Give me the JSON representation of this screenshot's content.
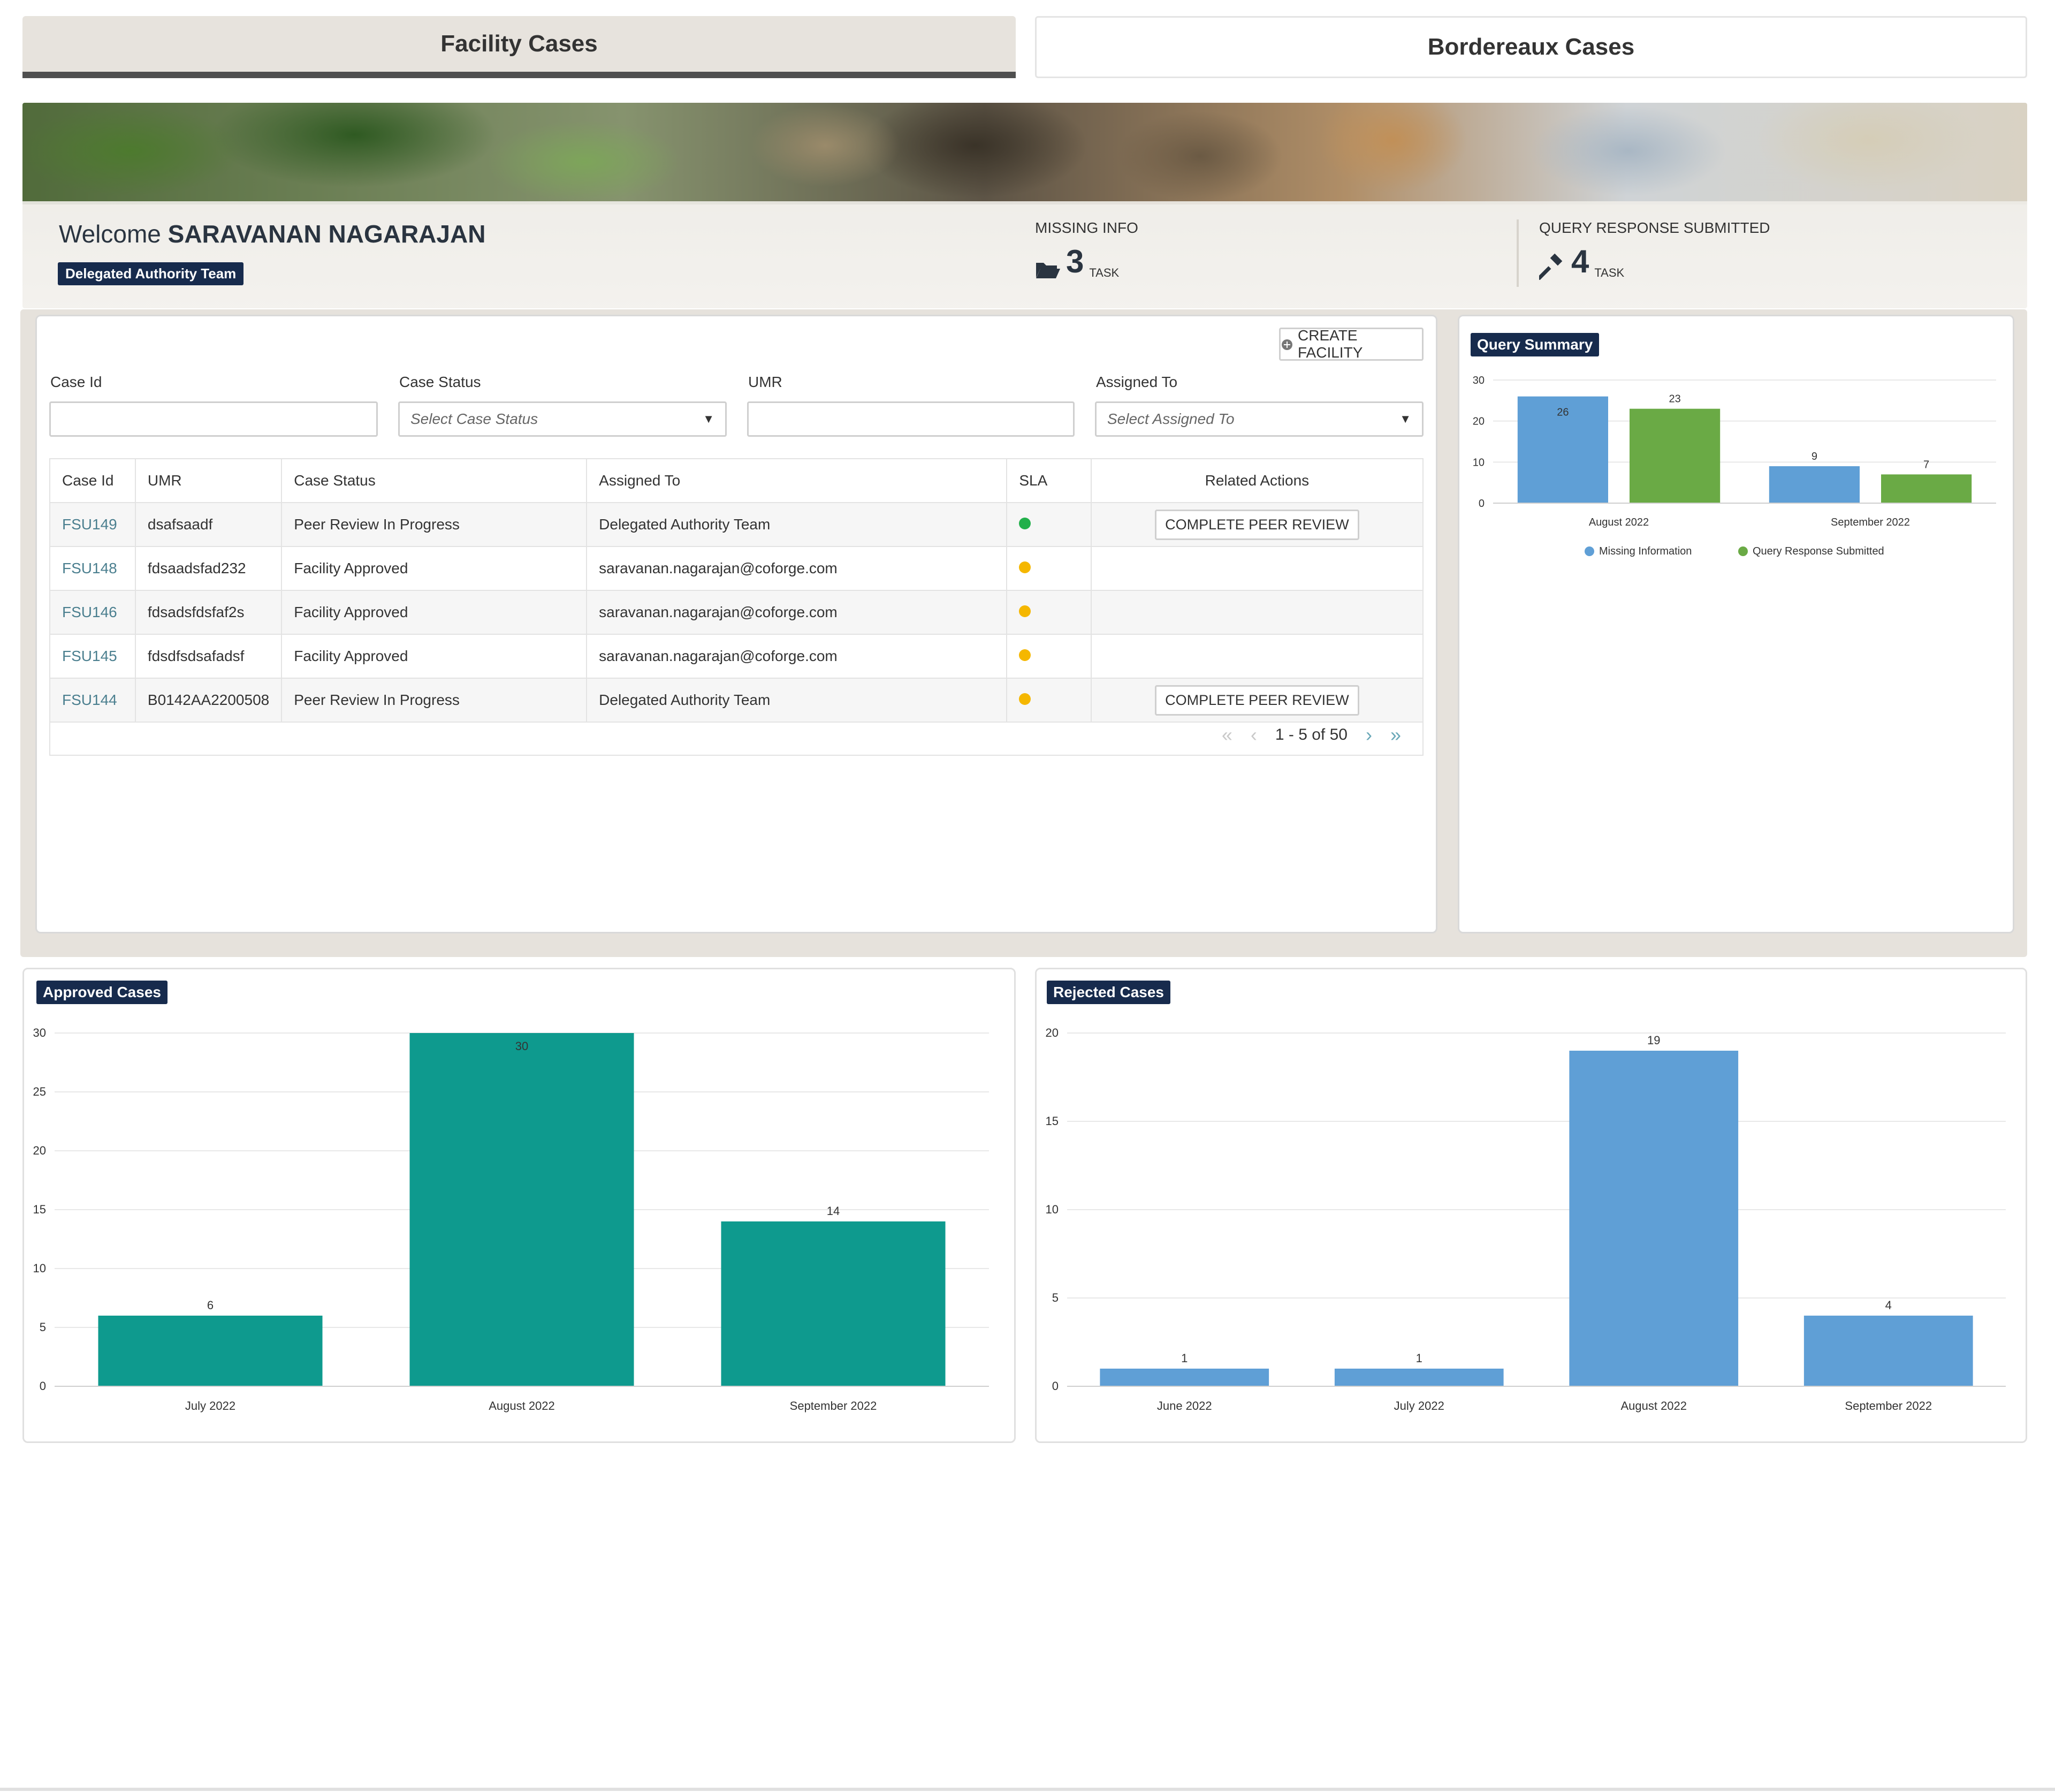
{
  "tabs": {
    "facility": "Facility Cases",
    "bordereaux": "Bordereaux Cases"
  },
  "banner": {
    "welcome_prefix": "Welcome",
    "user_name": "SARAVANAN NAGARAJAN",
    "team_badge": "Delegated Authority Team",
    "missing_info": {
      "label": "MISSING INFO",
      "value": "3",
      "unit": "TASK",
      "icon": "folder-open-icon"
    },
    "query_response": {
      "label": "QUERY RESPONSE SUBMITTED",
      "value": "4",
      "unit": "TASK",
      "icon": "hammer-icon"
    }
  },
  "toolbar": {
    "create_facility_label": "CREATE FACILITY",
    "create_icon": "plus-circle-icon"
  },
  "filters": {
    "case_id": {
      "label": "Case Id",
      "value": "",
      "placeholder": ""
    },
    "case_status": {
      "label": "Case Status",
      "placeholder": "Select Case Status"
    },
    "umr": {
      "label": "UMR",
      "value": "",
      "placeholder": ""
    },
    "assigned_to": {
      "label": "Assigned To",
      "placeholder": "Select Assigned To"
    }
  },
  "table": {
    "columns": [
      "Case Id",
      "UMR",
      "Case Status",
      "Assigned To",
      "SLA",
      "Related Actions"
    ],
    "rows": [
      {
        "case_id": "FSU149",
        "umr": "dsafsaadf",
        "status": "Peer Review In Progress",
        "assigned": "Delegated Authority Team",
        "sla_color": "#22b04b",
        "action": "COMPLETE PEER REVIEW"
      },
      {
        "case_id": "FSU148",
        "umr": "fdsaadsfad232",
        "status": "Facility Approved",
        "assigned": "saravanan.nagarajan@coforge.com",
        "sla_color": "#f5b700",
        "action": ""
      },
      {
        "case_id": "FSU146",
        "umr": "fdsadsfdsfaf2s",
        "status": "Facility Approved",
        "assigned": "saravanan.nagarajan@coforge.com",
        "sla_color": "#f5b700",
        "action": ""
      },
      {
        "case_id": "FSU145",
        "umr": "fdsdfsdsafadsf",
        "status": "Facility Approved",
        "assigned": "saravanan.nagarajan@coforge.com",
        "sla_color": "#f5b700",
        "action": ""
      },
      {
        "case_id": "FSU144",
        "umr": "B0142AA2200508",
        "status": "Peer Review In Progress",
        "assigned": "Delegated Authority Team",
        "sla_color": "#f5b700",
        "action": "COMPLETE PEER REVIEW"
      }
    ],
    "pagination": "1 - 5 of 50"
  },
  "colors": {
    "navy": "#172b4d",
    "teal": "#0e9a8e",
    "blue": "#5f9fd6",
    "green": "#6aaa45"
  },
  "chart_data": [
    {
      "type": "bar",
      "title": "Query Summary",
      "categories": [
        "August 2022",
        "September 2022"
      ],
      "series": [
        {
          "name": "Missing Information",
          "values": [
            26,
            9
          ],
          "color": "#5f9fd6"
        },
        {
          "name": "Query Response Submitted",
          "values": [
            23,
            7
          ],
          "color": "#6aaa45"
        }
      ],
      "ylim": [
        0,
        30
      ],
      "yticks": [
        0,
        10,
        20,
        30
      ],
      "grid": true,
      "legend": "bottom"
    },
    {
      "type": "bar",
      "title": "Approved Cases",
      "categories": [
        "July 2022",
        "August 2022",
        "September 2022"
      ],
      "values": [
        6,
        30,
        14
      ],
      "color": "#0e9a8e",
      "ylim": [
        0,
        30
      ],
      "yticks": [
        0,
        5,
        10,
        15,
        20,
        25,
        30
      ],
      "grid": true
    },
    {
      "type": "bar",
      "title": "Rejected Cases",
      "categories": [
        "June 2022",
        "July 2022",
        "August 2022",
        "September 2022"
      ],
      "values": [
        1,
        1,
        19,
        4
      ],
      "color": "#5f9fd6",
      "ylim": [
        0,
        20
      ],
      "yticks": [
        0,
        5,
        10,
        15,
        20
      ],
      "grid": true
    }
  ]
}
